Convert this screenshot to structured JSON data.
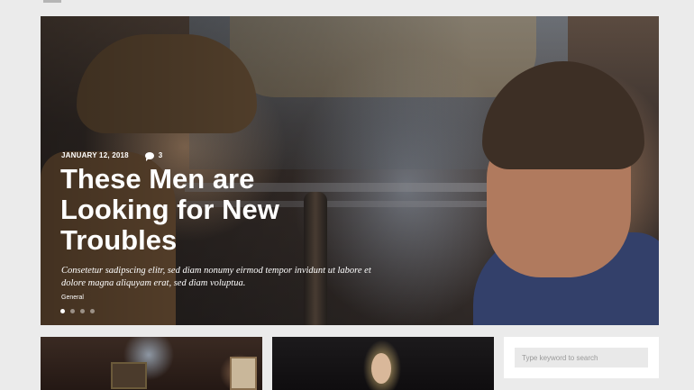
{
  "hero": {
    "date": "JANUARY 12, 2018",
    "comment_count": "3",
    "title": "These Men are Looking for New Troubles",
    "excerpt": "Consetetur sadipscing elitr, sed diam nonumy eirmod tempor invidunt ut labore et dolore magna aliquyam erat, sed diam voluptua.",
    "category": "General",
    "slider_dots": 4,
    "active_dot": 1
  },
  "search": {
    "placeholder": "Type keyword to search"
  },
  "icons": {
    "comment": "comment-icon"
  }
}
